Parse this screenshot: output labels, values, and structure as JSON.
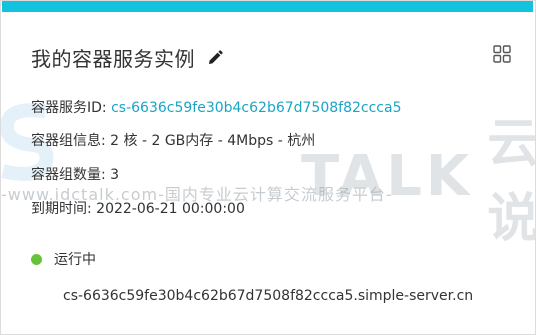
{
  "card": {
    "title": "我的容器服务实例",
    "accent_color": "#13c3dd",
    "edit_icon": "pencil-icon",
    "layout_icon": "grid-icon"
  },
  "details": {
    "id_label": "容器服务ID:",
    "id_value": "cs-6636c59fe30b4c62b67d7508f82ccca5",
    "spec_label": "容器组信息:",
    "spec_value": "2 核 - 2 GB内存 - 4Mbps - 杭州",
    "count_label": "容器组数量:",
    "count_value": "3",
    "expire_label": "到期时间:",
    "expire_value": "2022-06-21 00:00:00"
  },
  "status": {
    "text": "运行中",
    "color": "#67c23a"
  },
  "domain": "cs-6636c59fe30b4c62b67d7508f82ccca5.simple-server.cn",
  "watermark": {
    "brand": "TALK",
    "cn": "云说",
    "line": "-www.idctalk.com-国内专业云计算交流服务平台-"
  }
}
